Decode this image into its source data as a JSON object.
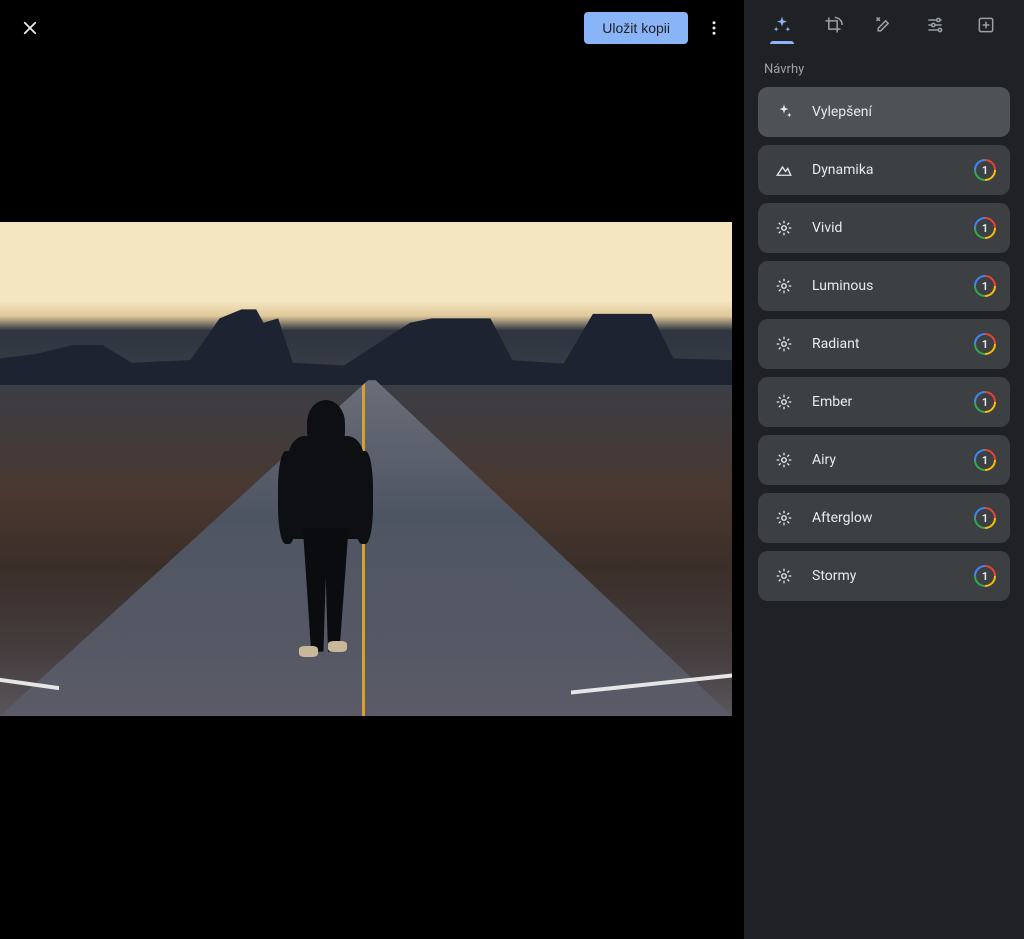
{
  "toolbar": {
    "save_label": "Uložit kopii"
  },
  "panel": {
    "section_title": "Návrhy",
    "cards": [
      {
        "label": "Vylepšení",
        "icon": "sparkle",
        "premium": false,
        "selected": true
      },
      {
        "label": "Dynamika",
        "icon": "dynamic",
        "premium": true,
        "selected": false
      },
      {
        "label": "Vivid",
        "icon": "sunburst",
        "premium": true,
        "selected": false
      },
      {
        "label": "Luminous",
        "icon": "sunburst",
        "premium": true,
        "selected": false
      },
      {
        "label": "Radiant",
        "icon": "sunburst",
        "premium": true,
        "selected": false
      },
      {
        "label": "Ember",
        "icon": "sunburst",
        "premium": true,
        "selected": false
      },
      {
        "label": "Airy",
        "icon": "sunburst",
        "premium": true,
        "selected": false
      },
      {
        "label": "Afterglow",
        "icon": "sunburst",
        "premium": true,
        "selected": false
      },
      {
        "label": "Stormy",
        "icon": "sunburst",
        "premium": true,
        "selected": false
      }
    ],
    "premium_badge_text": "1"
  }
}
